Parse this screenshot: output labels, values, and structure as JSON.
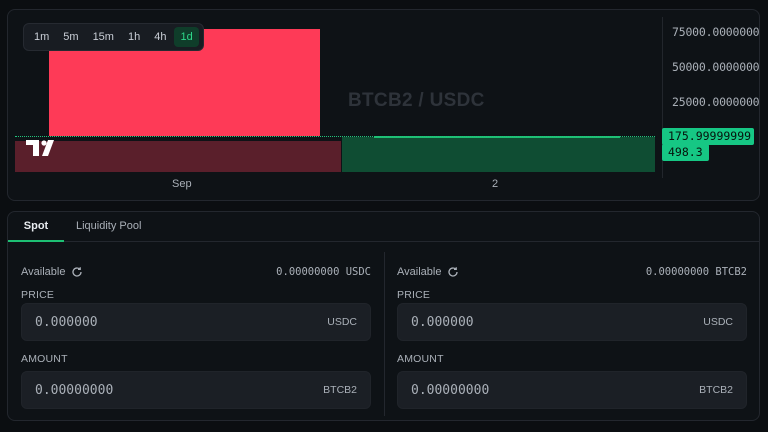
{
  "chart": {
    "pair": "BTCB2 / USDC",
    "timeframes": [
      "1m",
      "5m",
      "15m",
      "1h",
      "4h",
      "1d"
    ],
    "active_timeframe": "1d",
    "y_ticks": [
      "75000.00000000",
      "50000.00000000",
      "25000.00000000"
    ],
    "price_tag": "175.99999999",
    "volume_tag": "498.3",
    "x_ticks": [
      "Sep",
      "2"
    ],
    "colors": {
      "up": "#fe3a57",
      "down_volume": "#5a1f2b",
      "up_volume": "#0f4d33",
      "accent": "#16c784"
    }
  },
  "tabs": [
    "Spot",
    "Liquidity Pool"
  ],
  "active_tab": "Spot",
  "left": {
    "available_label": "Available",
    "available_value": "0.00000000 USDC",
    "price_label": "PRICE",
    "price_placeholder": "0.000000",
    "price_unit": "USDC",
    "amount_label": "AMOUNT",
    "amount_placeholder": "0.00000000",
    "amount_unit": "BTCB2"
  },
  "right": {
    "available_label": "Available",
    "available_value": "0.00000000 BTCB2",
    "price_label": "PRICE",
    "price_placeholder": "0.000000",
    "price_unit": "USDC",
    "amount_label": "AMOUNT",
    "amount_placeholder": "0.00000000",
    "amount_unit": "BTCB2"
  }
}
